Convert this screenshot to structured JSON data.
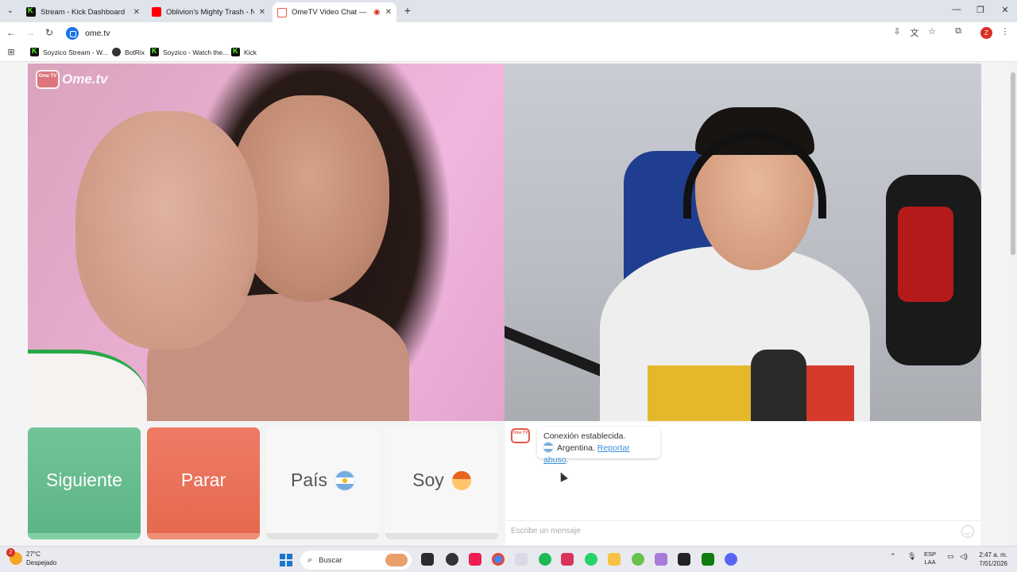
{
  "browser": {
    "tabs": [
      {
        "title": "Stream - Kick Dashboard",
        "color": "#53fc18"
      },
      {
        "title": "Oblivion's Mighty Trash - No M",
        "color": "#ff0000"
      },
      {
        "title": "OmeTV Video Chat — Ome",
        "color": "#e55a4a"
      }
    ],
    "url": "ome.tv",
    "profile_initial": "Z",
    "bookmarks": [
      {
        "label": "Soyzico Stream - W..."
      },
      {
        "label": "BotRix"
      },
      {
        "label": "Soyzico - Watch the..."
      },
      {
        "label": "Kick"
      }
    ]
  },
  "ometv": {
    "logo_small": "Ome TV",
    "logo_text": "Ome.tv",
    "buttons": {
      "next": "Siguiente",
      "stop": "Parar",
      "country": "País",
      "gender": "Soy"
    },
    "chat": {
      "avatar_text": "Ome TV",
      "status": "Conexión establecida.",
      "country": "Argentina.",
      "report": "Reportar abuso",
      "report_suffix": ".",
      "placeholder": "Escribe un mensaje"
    }
  },
  "taskbar": {
    "weather_badge": "2",
    "temperature": "27°C",
    "condition": "Despejado",
    "search": "Buscar",
    "lang_top": "ESP",
    "lang_bottom": "LAA",
    "time": "2:47 a. m.",
    "date": "7/01/2026"
  }
}
